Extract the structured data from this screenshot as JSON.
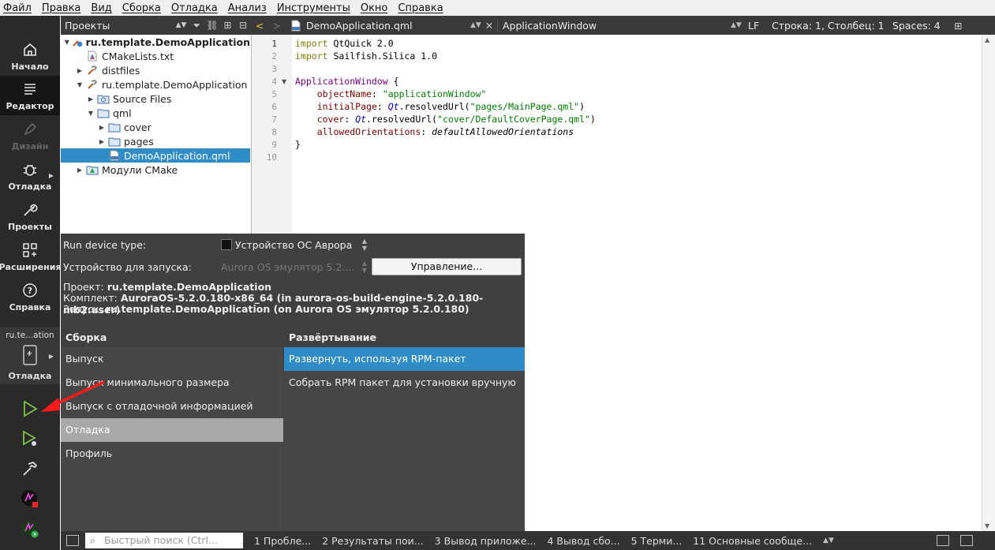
{
  "menu": [
    "Файл",
    "Правка",
    "Вид",
    "Сборка",
    "Отладка",
    "Анализ",
    "Инструменты",
    "Окно",
    "Справка"
  ],
  "modes": [
    {
      "label": "Начало",
      "icon": "home-icon"
    },
    {
      "label": "Редактор",
      "icon": "editor-icon"
    },
    {
      "label": "Дизайн",
      "icon": "design-icon"
    },
    {
      "label": "Отладка",
      "icon": "debug-icon"
    },
    {
      "label": "Проекты",
      "icon": "projects-icon"
    },
    {
      "label": "Расширения",
      "icon": "extensions-icon"
    },
    {
      "label": "Справка",
      "icon": "help-icon"
    }
  ],
  "kit": {
    "name": "ru.te...ation",
    "mode": "Отладка"
  },
  "projects": {
    "title": "Проекты",
    "tree": [
      {
        "label": "ru.template.DemoApplication",
        "depth": 0,
        "twist": "open",
        "icon": "project-icon",
        "bold": true
      },
      {
        "label": "CMakeLists.txt",
        "depth": 1,
        "twist": "",
        "icon": "cmake-file-icon"
      },
      {
        "label": "distfiles",
        "depth": 1,
        "twist": "closed",
        "icon": "hammer-icon"
      },
      {
        "label": "ru.template.DemoApplication",
        "depth": 1,
        "twist": "open",
        "icon": "hammer-icon"
      },
      {
        "label": "Source Files",
        "depth": 2,
        "twist": "closed",
        "icon": "source-folder-icon"
      },
      {
        "label": "qml",
        "depth": 2,
        "twist": "open",
        "icon": "folder-icon"
      },
      {
        "label": "cover",
        "depth": 3,
        "twist": "closed",
        "icon": "folder-icon"
      },
      {
        "label": "pages",
        "depth": 3,
        "twist": "closed",
        "icon": "folder-icon"
      },
      {
        "label": "DemoApplication.qml",
        "depth": 3,
        "twist": "",
        "icon": "qml-file-icon",
        "selected": true
      },
      {
        "label": "Модули CMake",
        "depth": 1,
        "twist": "closed",
        "icon": "cmake-modules-icon"
      }
    ]
  },
  "editor": {
    "file": "DemoApplication.qml",
    "symbol": "ApplicationWindow",
    "line_ending": "LF",
    "position": "Строка: 1, Столбец: 1",
    "spaces": "Spaces: 4",
    "lines": [
      [
        [
          "kw",
          "import"
        ],
        [
          "",
          " QtQuick 2.0"
        ]
      ],
      [
        [
          "kw",
          "import"
        ],
        [
          "",
          " Sailfish.Silica 1.0"
        ]
      ],
      [],
      [
        [
          "ty",
          "ApplicationWindow"
        ],
        [
          "",
          " {"
        ]
      ],
      [
        [
          "",
          "    "
        ],
        [
          "pr",
          "objectName"
        ],
        [
          "",
          ": "
        ],
        [
          "st",
          "\"applicationWindow\""
        ]
      ],
      [
        [
          "",
          "    "
        ],
        [
          "pr",
          "initialPage"
        ],
        [
          "",
          ": "
        ],
        [
          "qt",
          "Qt"
        ],
        [
          "",
          ".resolvedUrl("
        ],
        [
          "st",
          "\"pages/MainPage.qml\""
        ],
        [
          "",
          ")"
        ]
      ],
      [
        [
          "",
          "    "
        ],
        [
          "pr",
          "cover"
        ],
        [
          "",
          ": "
        ],
        [
          "qt",
          "Qt"
        ],
        [
          "",
          ".resolvedUrl("
        ],
        [
          "st",
          "\"cover/DefaultCoverPage.qml\""
        ],
        [
          "",
          ")"
        ]
      ],
      [
        [
          "",
          "    "
        ],
        [
          "pr",
          "allowedOrientations"
        ],
        [
          "",
          ": "
        ],
        [
          "it",
          "defaultAllowedOrientations"
        ]
      ],
      [
        [
          "",
          "}"
        ]
      ],
      []
    ]
  },
  "popup": {
    "run_device_type_label": "Run device type:",
    "run_device_type_value": "Устройство ОС Аврора",
    "device_label": "Устройство для запуска:",
    "device_value": "Aurora OS эмулятор 5.2....",
    "manage_button": "Управление...",
    "project_label": "Проект:",
    "project_value": "ru.template.DemoApplication",
    "kit_label": "Комплект:",
    "kit_value": "AuroraOS-5.2.0.180-x86_64 (in aurora-os-build-engine-5.2.0.180-mb2:user)",
    "run_label": "Запуск:",
    "run_value": "ru.template.DemoApplication (on Aurora OS эмулятор 5.2.0.180)",
    "build_header": "Сборка",
    "deploy_header": "Развёртывание",
    "build_items": [
      "Выпуск",
      "Выпуск минимального размера",
      "Выпуск с отладочной информацией",
      "Отладка",
      "Профиль"
    ],
    "build_selected": 3,
    "deploy_items": [
      "Развернуть, используя RPM-пакет",
      "Собрать RPM пакет для установки вручную"
    ],
    "deploy_selected": 0
  },
  "statusbar": {
    "search_placeholder": "Быстрый поиск (Ctrl...",
    "panes": [
      "1  Пробле...",
      "2  Результаты пои...",
      "3  Вывод приложе...",
      "4  Вывод сбо...",
      "5  Терми...",
      "11  Основные сообще..."
    ]
  },
  "colors": {
    "accent": "#308cc6",
    "run_green": "#7dc142",
    "annotation_red": "#ff1a1a"
  }
}
